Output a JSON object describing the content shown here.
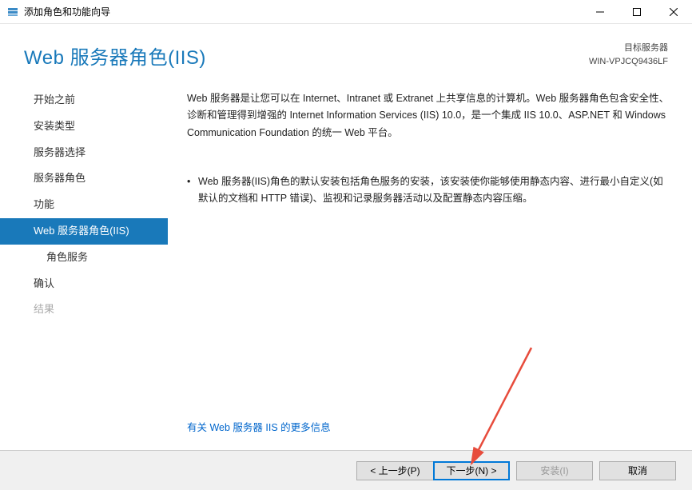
{
  "window": {
    "title": "添加角色和功能向导"
  },
  "header": {
    "heading": "Web 服务器角色(IIS)",
    "target_label": "目标服务器",
    "target_server": "WIN-VPJCQ9436LF"
  },
  "sidebar": {
    "items": [
      {
        "label": "开始之前",
        "selected": false,
        "sub": false,
        "disabled": false
      },
      {
        "label": "安装类型",
        "selected": false,
        "sub": false,
        "disabled": false
      },
      {
        "label": "服务器选择",
        "selected": false,
        "sub": false,
        "disabled": false
      },
      {
        "label": "服务器角色",
        "selected": false,
        "sub": false,
        "disabled": false
      },
      {
        "label": "功能",
        "selected": false,
        "sub": false,
        "disabled": false
      },
      {
        "label": "Web 服务器角色(IIS)",
        "selected": true,
        "sub": false,
        "disabled": false
      },
      {
        "label": "角色服务",
        "selected": false,
        "sub": true,
        "disabled": false
      },
      {
        "label": "确认",
        "selected": false,
        "sub": false,
        "disabled": false
      },
      {
        "label": "结果",
        "selected": false,
        "sub": false,
        "disabled": true
      }
    ]
  },
  "content": {
    "intro": "Web 服务器是让您可以在 Internet、Intranet 或 Extranet 上共享信息的计算机。Web 服务器角色包含安全性、诊断和管理得到增强的 Internet Information Services (IIS) 10.0，是一个集成 IIS 10.0、ASP.NET 和 Windows Communication Foundation 的统一 Web 平台。",
    "bullets": [
      "Web 服务器(IIS)角色的默认安装包括角色服务的安装，该安装使你能够使用静态内容、进行最小自定义(如默认的文档和 HTTP 错误)、监视和记录服务器活动以及配置静态内容压缩。"
    ],
    "more_link": "有关 Web 服务器 IIS 的更多信息"
  },
  "footer": {
    "prev": "< 上一步(P)",
    "next": "下一步(N) >",
    "install": "安装(I)",
    "cancel": "取消"
  }
}
